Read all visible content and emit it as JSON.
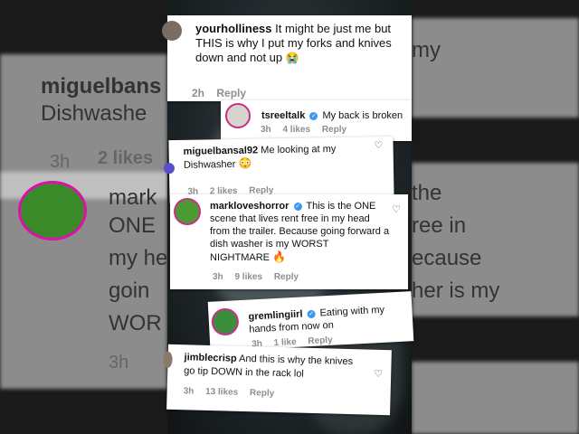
{
  "comments": [
    {
      "username": "yourholliness",
      "text": "It might be just me but THIS is why I put my forks and knives down and not up",
      "emoji": "😭",
      "time": "2h",
      "reply": "Reply"
    },
    {
      "username": "tsreeltalk",
      "verified": true,
      "text": "My back is broken",
      "time": "3h",
      "likes": "4 likes",
      "reply": "Reply"
    },
    {
      "username": "miguelbansal92",
      "text": "Me looking at my Dishwasher",
      "emoji": "😳",
      "time": "3h",
      "likes": "2 likes",
      "reply": "Reply"
    },
    {
      "username": "markloveshorror",
      "verified": true,
      "text": "This is the ONE scene that lives rent free in my head from the trailer. Because going forward a dish washer is my WORST NIGHTMARE",
      "emoji": "🔥",
      "time": "3h",
      "likes": "9 likes",
      "reply": "Reply"
    },
    {
      "username": "gremlingiirl",
      "verified": true,
      "text": "Eating with my hands from now on",
      "time": "3h",
      "likes": "1 like",
      "reply": "Reply"
    },
    {
      "username": "jimblecrisp",
      "text": "And this is why the knives go tip DOWN in the rack lol",
      "time": "3h",
      "likes": "13 likes",
      "reply": "Reply"
    }
  ],
  "background": {
    "left_user": "miguelbans",
    "left_text": "Dishwashe",
    "left_time": "3h",
    "left_likes": "2 likes",
    "left_lines": [
      "mark",
      "ONE",
      "my he",
      "goin",
      "WOR"
    ],
    "left_time2": "3h",
    "right_top": "my",
    "right_lines": [
      "the",
      "ree in",
      "ecause",
      "her is my"
    ]
  },
  "icons": {
    "heart": "heart-icon",
    "verified": "verified-badge-icon"
  }
}
